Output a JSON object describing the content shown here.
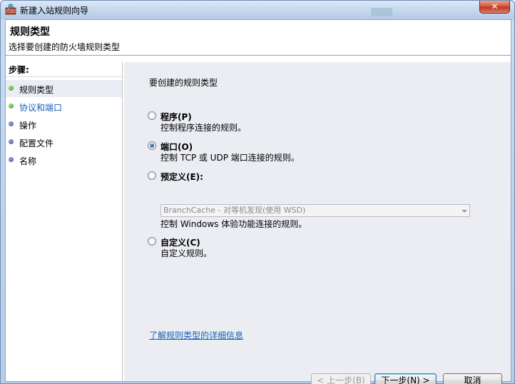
{
  "window": {
    "title": "新建入站规则向导",
    "close_glyph": "✕"
  },
  "header": {
    "title": "规则类型",
    "subtitle": "选择要创建的防火墙规则类型"
  },
  "steps": {
    "label": "步骤:",
    "items": [
      {
        "label": "规则类型",
        "status": "green"
      },
      {
        "label": "协议和端口",
        "status": "green"
      },
      {
        "label": "操作",
        "status": "blue"
      },
      {
        "label": "配置文件",
        "status": "blue"
      },
      {
        "label": "名称",
        "status": "blue"
      }
    ]
  },
  "content": {
    "prompt": "要创建的规则类型",
    "options": [
      {
        "label": "程序(P)",
        "desc": "控制程序连接的规则。",
        "checked": false
      },
      {
        "label": "端口(O)",
        "desc": "控制 TCP 或 UDP 端口连接的规则。",
        "checked": true
      },
      {
        "label": "预定义(E):",
        "desc": "控制 Windows 体验功能连接的规则。",
        "checked": false
      },
      {
        "label": "自定义(C)",
        "desc": "自定义规则。",
        "checked": false
      }
    ],
    "predefined_select": "BranchCache - 对等机发现(使用 WSD)",
    "learn_more": "了解规则类型的详细信息"
  },
  "buttons": {
    "back": "< 上一步(B)",
    "next": "下一步(N) >",
    "cancel": "取消"
  },
  "colors": {
    "step_done": "#2e9a1e",
    "step_pending": "#3c48a8",
    "link": "#1a5fb4",
    "pane_bg": "#ebedf2"
  }
}
